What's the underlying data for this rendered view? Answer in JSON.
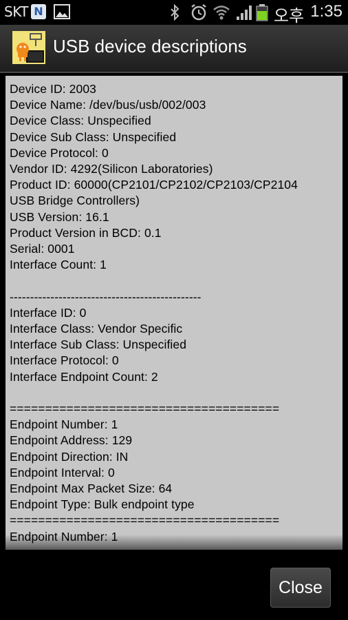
{
  "status_bar": {
    "carrier": "SKT",
    "notification_badge": "N",
    "ampm": "오후",
    "time": "1:35",
    "icons": [
      "notification-n-icon",
      "gallery-icon",
      "bluetooth-icon",
      "alarm-icon",
      "wifi-icon",
      "signal-icon",
      "battery-icon"
    ]
  },
  "title_bar": {
    "title": "USB device descriptions",
    "icon": "usb-android-app-icon"
  },
  "content": {
    "lines": [
      "Device ID: 2003",
      "Device Name: /dev/bus/usb/002/003",
      "Device Class: Unspecified",
      "Device Sub Class: Unspecified",
      "Device Protocol: 0",
      "Vendor ID: 4292(Silicon Laboratories)",
      "Product ID: 60000(CP2101/CP2102/CP2103/CP2104",
      "USB Bridge Controllers)",
      "USB Version: 16.1",
      "Product Version in BCD: 0.1",
      "Serial: 0001",
      "Interface Count: 1",
      "",
      "-----------------------------------------------",
      "Interface ID: 0",
      "Interface Class: Vendor Specific",
      "Interface Sub Class: Unspecified",
      "Interface Protocol: 0",
      "Interface Endpoint Count: 2",
      "",
      "======================================",
      "Endpoint Number: 1",
      "Endpoint Address: 129",
      "Endpoint Direction: IN",
      "Endpoint Interval: 0",
      "Endpoint Max Packet Size: 64",
      "Endpoint Type: Bulk endpoint type",
      "======================================",
      "Endpoint Number: 1"
    ]
  },
  "buttons": {
    "close_label": "Close"
  }
}
